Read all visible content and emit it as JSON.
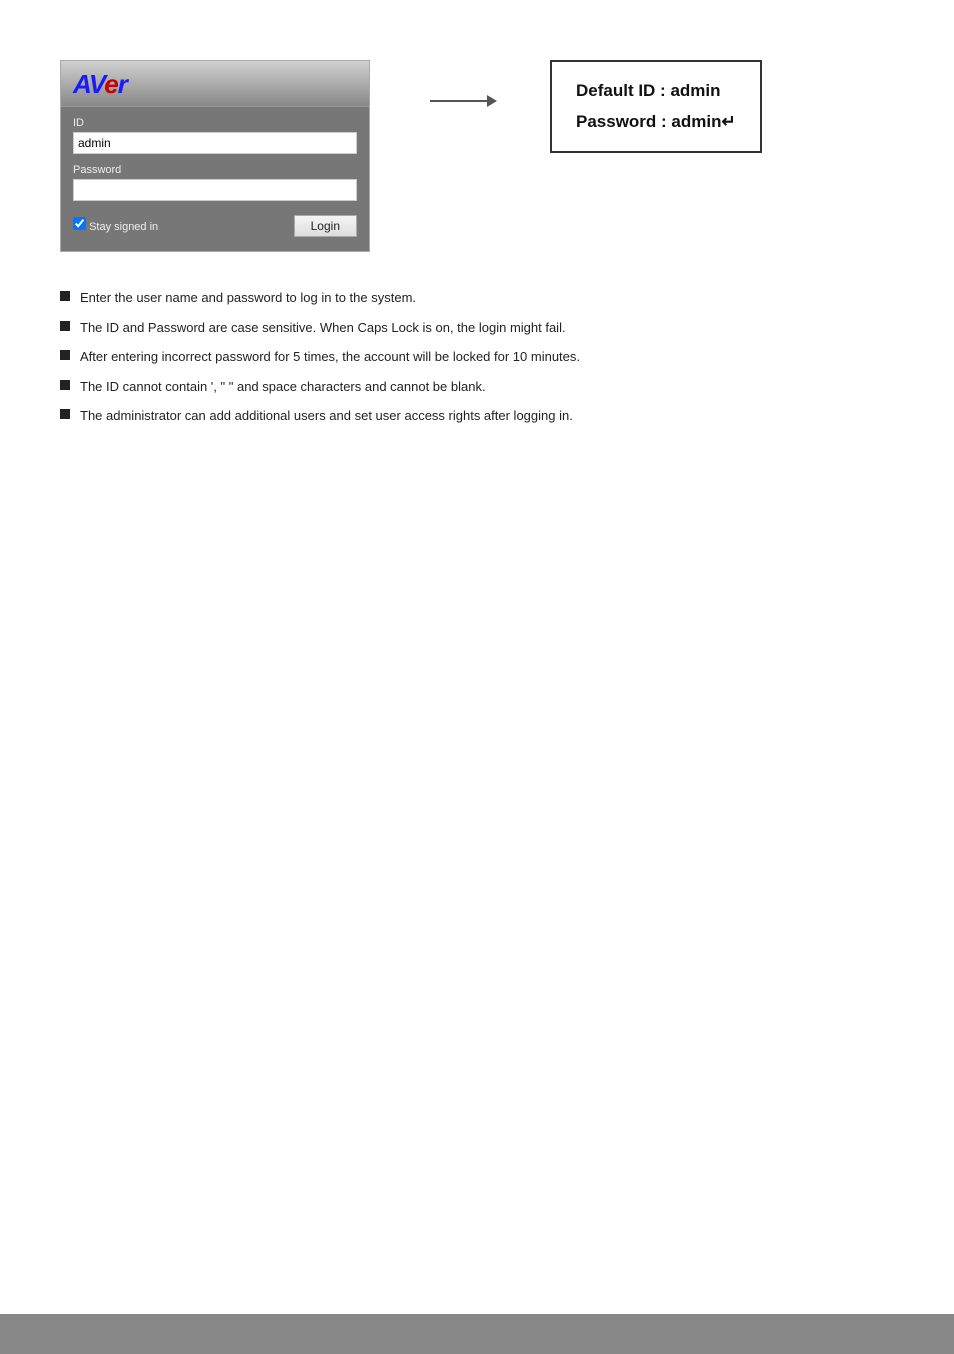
{
  "logo": {
    "av": "AV",
    "e": "e",
    "r": "r"
  },
  "login": {
    "id_label": "ID",
    "id_value": "admin",
    "password_label": "Password",
    "password_value": "",
    "stay_signed_label": "Stay signed in",
    "login_button": "Login"
  },
  "callout": {
    "line1": "Default ID  : admin",
    "line2": "Password  : admin↵"
  },
  "bullets": [
    {
      "text": "Enter the user name and password to log in to the system."
    },
    {
      "text": "The ID and Password are case sensitive. When Caps Lock is on, the login might fail."
    },
    {
      "text": "After entering incorrect password for 5 times, the account will be locked for 10 minutes."
    },
    {
      "text": "The ID cannot contain ', \" \" and space characters and cannot be blank."
    },
    {
      "text": "The administrator can add additional users and set user access rights after logging in."
    }
  ]
}
